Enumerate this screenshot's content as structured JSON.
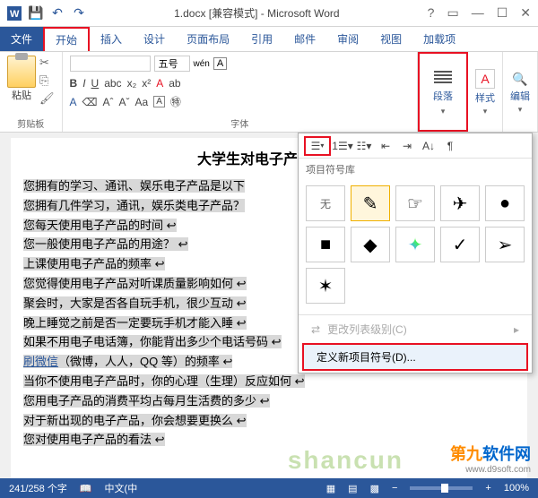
{
  "titlebar": {
    "title": "1.docx [兼容模式] - Microsoft Word"
  },
  "tabs": {
    "file": "文件",
    "home": "开始",
    "insert": "插入",
    "design": "设计",
    "layout": "页面布局",
    "refs": "引用",
    "mail": "邮件",
    "review": "审阅",
    "view": "视图",
    "addins": "加载项"
  },
  "ribbon": {
    "paste": "粘贴",
    "clipboard": "剪贴板",
    "font_size": "五号",
    "font_a": "wén",
    "font_A": "A",
    "font_group": "字体",
    "para": "段落",
    "styles": "样式",
    "edit": "编辑"
  },
  "doc": {
    "title": "大学生对电子产品的使",
    "lines": [
      "您拥有的学习、通讯、娱乐电子产品是以下",
      "您拥有几件学习，通讯，娱乐类电子产品？",
      "您每天使用电子产品的时间 ↩",
      "您一般使用电子产品的用途？ ↩",
      "上课使用电子产品的频率 ↩",
      "您觉得使用电子产品对听课质量影响如何 ↩",
      "聚会时，大家是否各自玩手机，很少互动 ↩",
      "晚上睡觉之前是否一定要玩手机才能入睡 ↩",
      "如果不用电子电话簿，你能背出多少个电话号码 ↩",
      "刷微信（微博，人人，QQ 等）的频率 ↩",
      "当你不使用电子产品时，你的心理（生理）反应如何 ↩",
      "您用电子产品的消费平均占每月生活费的多少 ↩",
      "对于新出现的电子产品，你会想要更换么 ↩",
      "您对使用电子产品的看法 ↩"
    ]
  },
  "dropdown": {
    "lib": "项目符号库",
    "none": "无",
    "change_level": "更改列表级别(C)",
    "define_new": "定义新项目符号(D)..."
  },
  "status": {
    "words": "241/258 个字",
    "lang": "中文(中",
    "zoom": "100%"
  },
  "watermark": {
    "cn1": "第九",
    "cn2": "软件网",
    "url": "www.d9soft.com",
    "shancun": "shancun"
  }
}
